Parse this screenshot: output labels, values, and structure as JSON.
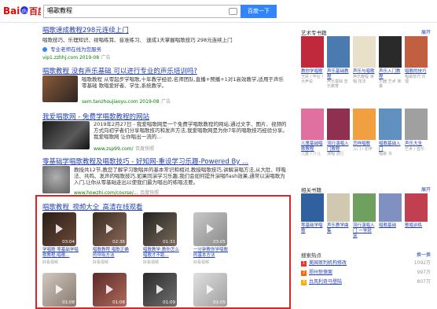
{
  "search": {
    "query": "唱歌教程",
    "button": "百度一下"
  },
  "results": [
    {
      "title": "唱歌速成教程298元连续上门",
      "abstract": "唱歌技巧、乐理知识、视唱练耳、音准练习、 速成1天掌握唱歌技巧 298元连续上门",
      "link_text": "专业老师在线为您服务",
      "url": "vip1.zzhhj.com  2019-08",
      "ad": "广告"
    },
    {
      "title": "唱歌教程 没有声乐基础 可以进行专业的声乐培训吗?",
      "abstract": "唱歌教程 从零起步学唱歌,十年教学经验,名师团队,直播+预播+1对1高效教学,适用于声乐零基础 歌唱爱好者、学生,系统教学。",
      "url": "sem.tanzhoujiaoyu.com  2019-08",
      "ad": "广告"
    },
    {
      "title": "我爱唱歌网 - 免费学唱歌教程的网站",
      "abstract": "2019年2月27日 - 我爱唱歌网是一个免费学唱歌教程的网站,通过文字、图片、视频的方式向初学者们分享唱歌技巧和发声方法,我爱唱歌网是为你7年的唱歌技巧经验分享。我爱唱歌网 让你唱出一流的...",
      "url": "www.zsp99.com/",
      "snapshot": "百度快照"
    },
    {
      "title": "零基础学唱歌教程及唱歌技巧 - 好知网-重设学习乐趣-Powered By ...",
      "abstract": "教授共12节,教您了解学习歌唱并的基本常识和相对,教授唱歌技巧,讲解演唱方法,从大肚、呼吸法、共鸣、发声的唱歌技巧,如果同演学习乐趣,我们会如何提升演唱flash效果,通常以演唱歌为入门,让你从零基础走出以使我们最为唱出的练唱法要。",
      "url": "www.howzhi.com/course/...",
      "snapshot": "百度快照"
    }
  ],
  "video_section": {
    "title": "唱歌教程_视频大全_高清在线观看",
    "videos": [
      {
        "duration": "03:04",
        "caption": "学唱歌 零基础学唱歌教程,唱歌...",
        "source": "好看视频"
      },
      {
        "duration": "02:36",
        "caption": "唱歌教程 唱歌正确的呼吸方法",
        "source": "好看视频"
      },
      {
        "duration": "01:31",
        "caption": "唱歌教学:教你怎么唱歌才不跑...",
        "source": "好看视频"
      },
      {
        "duration": "03:05",
        "caption": "一分钟教你学唱歌的基本方法",
        "source": "好看视频"
      },
      {
        "duration": "01:08",
        "caption": "",
        "source": ""
      },
      {
        "duration": "01:08",
        "caption": "",
        "source": ""
      },
      {
        "duration": "01:09",
        "caption": "",
        "source": ""
      },
      {
        "duration": "01:05",
        "caption": "",
        "source": ""
      }
    ]
  },
  "art_books": {
    "title": "艺术专书籍",
    "more": "展开",
    "books": [
      {
        "title": "教你学唱歌",
        "sub": "王民 / 毕业 / 大声说"
      },
      {
        "title": "声乐基础教程",
        "sub": "声乐基础 音乐教育"
      },
      {
        "title": "声乐与唱歌",
        "sub": "声乐教程 演唱 技法"
      },
      {
        "title": "声乐入门教程",
        "sub": "乐器 艺术 演奏"
      },
      {
        "title": "唱歌的技巧",
        "sub": "唱歌技巧 乐理"
      },
      {
        "title": "儿童基础唱歌教程",
        "sub": "儿童 / 少儿"
      },
      {
        "title": "流行演唱入门教程",
        "sub": "演唱 流行"
      },
      {
        "title": "怎样唱歌",
        "sub": "入门 / 初学"
      },
      {
        "title": "唱歌基础入门",
        "sub": "唱歌 书"
      },
      {
        "title": "声乐大全",
        "sub": "艺术 / 音乐"
      }
    ]
  },
  "related_books": {
    "title": "相关书籍",
    "more": "展开",
    "books": [
      {
        "title": "零基础学唱歌",
        "sub": ""
      },
      {
        "title": "声乐教学曲集",
        "sub": ""
      },
      {
        "title": "流行演唱入门 一学就会",
        "sub": ""
      },
      {
        "title": "唱歌基础",
        "sub": ""
      },
      {
        "title": "歌唱训练",
        "sub": ""
      }
    ]
  },
  "hot_search": {
    "title": "搜索热点",
    "action": "换一换",
    "items": [
      {
        "text": "美国审判机构修改",
        "count": "1092万",
        "color": "#e33"
      },
      {
        "text": "郑州惊悚案",
        "count": "997万",
        "color": "#f60"
      },
      {
        "text": "台风利奇马登陆",
        "count": "807万",
        "color": "#fa0"
      }
    ]
  }
}
